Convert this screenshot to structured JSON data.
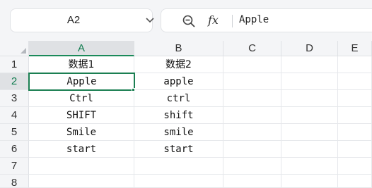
{
  "name_box": {
    "value": "A2"
  },
  "formula_bar": {
    "fx_label": "fx",
    "value": "Apple"
  },
  "columns": [
    "A",
    "B",
    "C",
    "D",
    "E"
  ],
  "rows": [
    "1",
    "2",
    "3",
    "4",
    "5",
    "6",
    "7",
    "8"
  ],
  "selected": {
    "column": "A",
    "row": "2"
  },
  "cells": {
    "A1": "数据1",
    "B1": "数据2",
    "A2": "Apple",
    "B2": "apple",
    "A3": "Ctrl",
    "B3": "ctrl",
    "A4": "SHIFT",
    "B4": "shift",
    "A5": "Smile",
    "B5": "smile",
    "A6": "start",
    "B6": "start"
  },
  "icons": {
    "name_box_dropdown": "chevron-down-icon",
    "zoom": "zoom-icon"
  },
  "colors": {
    "accent": "#1b7f52"
  }
}
